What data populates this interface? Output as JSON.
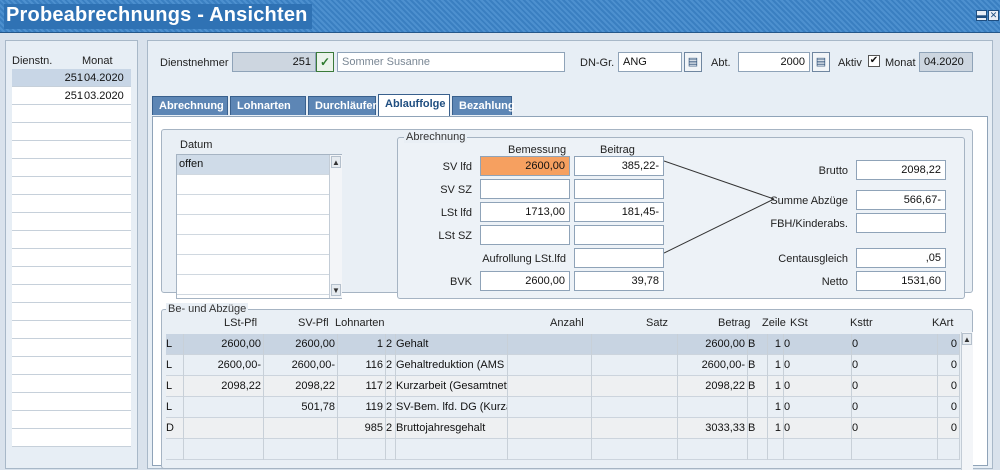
{
  "window": {
    "title": "Probeabrechnungs - Ansichten",
    "minimize_glyph": "▬",
    "close_glyph": "✕"
  },
  "left": {
    "headers": {
      "dienstn": "Dienstn.",
      "monat": "Monat"
    },
    "rows": [
      {
        "dienstn": "251",
        "monat": "04.2020",
        "selected": true
      },
      {
        "dienstn": "251",
        "monat": "03.2020",
        "selected": false
      }
    ],
    "empty_rows": 19
  },
  "header": {
    "dienstnehmer_label": "Dienstnehmer",
    "dienstnehmer_nr": "251",
    "dienstnehmer_name": "Sommer Susanne",
    "dngr_label": "DN-Gr.",
    "dngr_value": "ANG",
    "abt_label": "Abt.",
    "abt_value": "2000",
    "aktiv_label": "Aktiv",
    "aktiv_checked": true,
    "monat_label": "Monat",
    "monat_value": "04.2020"
  },
  "tabs": [
    {
      "label": "Abrechnung",
      "active": false
    },
    {
      "label": "Lohnarten",
      "active": false
    },
    {
      "label": "Durchläufer",
      "active": false
    },
    {
      "label": "Ablauffolge",
      "active": true
    },
    {
      "label": "Bezahlung",
      "active": false
    }
  ],
  "datum": {
    "title": "Datum",
    "items": [
      "offen",
      "",
      "",
      "",
      "",
      "",
      ""
    ]
  },
  "abrechnung": {
    "title": "Abrechnung",
    "col_bemessung": "Bemessung",
    "col_beitrag": "Beitrag",
    "rows": [
      {
        "label": "SV lfd",
        "bemessung": "2600,00",
        "beitrag": "385,22-"
      },
      {
        "label": "SV SZ",
        "bemessung": "",
        "beitrag": ""
      },
      {
        "label": "LSt lfd",
        "bemessung": "1713,00",
        "beitrag": "181,45-"
      },
      {
        "label": "LSt SZ",
        "bemessung": "",
        "beitrag": ""
      }
    ],
    "aufrollung_label": "Aufrollung LSt.lfd",
    "aufrollung_value": "",
    "bvk_label": "BVK",
    "bvk_bemessung": "2600,00",
    "bvk_beitrag": "39,78",
    "brutto_label": "Brutto",
    "brutto_value": "2098,22",
    "summe_label": "Summe Abzüge",
    "summe_value": "566,67-",
    "fbh_label": "FBH/Kinderabs.",
    "fbh_value": "",
    "cent_label": "Centausgleich",
    "cent_value": ",05",
    "netto_label": "Netto",
    "netto_value": "1531,60"
  },
  "bezuege": {
    "title": "Be- und Abzüge",
    "headers": {
      "lst": "LSt-Pfl",
      "sv": "SV-Pfl",
      "lohnarten": "Lohnarten",
      "anzahl": "Anzahl",
      "satz": "Satz",
      "betrag": "Betrag",
      "zeile": "Zeile",
      "kst": "KSt",
      "ksttr": "Ksttr",
      "kart": "KArt"
    },
    "rows": [
      {
        "typ": "L",
        "lst": "2600,00",
        "sv": "2600,00",
        "nr": "1",
        "flag": "2",
        "text": "Gehalt",
        "anzahl": "",
        "satz": "",
        "betrag": "2600,00",
        "b": "B",
        "zeile": "1",
        "kst": "0",
        "ksttr": "0",
        "kart": "0"
      },
      {
        "typ": "L",
        "lst": "2600,00-",
        "sv": "2600,00-",
        "nr": "116",
        "flag": "2",
        "text": "Gehaltreduktion (AMS l",
        "anzahl": "",
        "satz": "",
        "betrag": "2600,00-",
        "b": "B",
        "zeile": "1",
        "kst": "0",
        "ksttr": "0",
        "kart": "0"
      },
      {
        "typ": "L",
        "lst": "2098,22",
        "sv": "2098,22",
        "nr": "117",
        "flag": "2",
        "text": "Kurzarbeit (Gesamtnett",
        "anzahl": "",
        "satz": "",
        "betrag": "2098,22",
        "b": "B",
        "zeile": "1",
        "kst": "0",
        "ksttr": "0",
        "kart": "0"
      },
      {
        "typ": "L",
        "lst": "",
        "sv": "501,78",
        "nr": "119",
        "flag": "2",
        "text": "SV-Bem. lfd. DG (Kurza",
        "anzahl": "",
        "satz": "",
        "betrag": "",
        "b": "",
        "zeile": "1",
        "kst": "0",
        "ksttr": "0",
        "kart": "0"
      },
      {
        "typ": "D",
        "lst": "",
        "sv": "",
        "nr": "985",
        "flag": "2",
        "text": "Bruttojahresgehalt",
        "anzahl": "",
        "satz": "",
        "betrag": "3033,33",
        "b": "B",
        "zeile": "1",
        "kst": "0",
        "ksttr": "0",
        "kart": "0"
      },
      {
        "typ": "",
        "lst": "",
        "sv": "",
        "nr": "",
        "flag": "",
        "text": "",
        "anzahl": "",
        "satz": "",
        "betrag": "",
        "b": "",
        "zeile": "",
        "kst": "",
        "ksttr": "",
        "kart": ""
      }
    ]
  },
  "icons": {
    "check": "✓",
    "calendar": "▤",
    "checkbox": "✔",
    "up": "▲",
    "down": "▼"
  }
}
